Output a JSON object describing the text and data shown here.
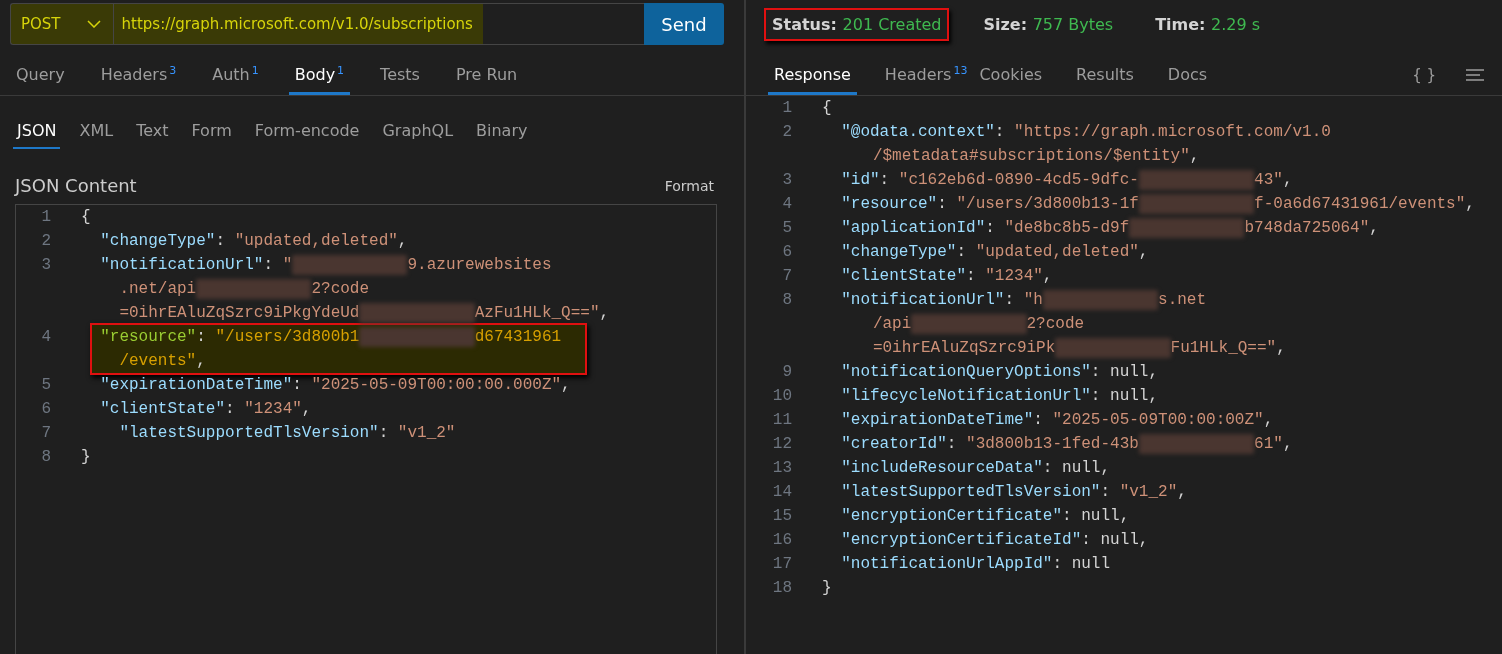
{
  "request": {
    "method": "POST",
    "url": "https://graph.microsoft.com/v1.0/subscriptions",
    "highlighted": true,
    "send": "Send"
  },
  "request_tabs": [
    {
      "label": "Query",
      "selected": false
    },
    {
      "label": "Headers",
      "count": "3",
      "selected": false
    },
    {
      "label": "Auth",
      "count": "1",
      "selected": false
    },
    {
      "label": "Body",
      "count": "1",
      "selected": true
    },
    {
      "label": "Tests",
      "selected": false
    },
    {
      "label": "Pre Run",
      "selected": false
    }
  ],
  "body_tabs": [
    {
      "label": "JSON",
      "selected": true
    },
    {
      "label": "XML",
      "selected": false
    },
    {
      "label": "Text",
      "selected": false
    },
    {
      "label": "Form",
      "selected": false
    },
    {
      "label": "Form-encode",
      "selected": false
    },
    {
      "label": "GraphQL",
      "selected": false
    },
    {
      "label": "Binary",
      "selected": false
    }
  ],
  "body_title": "JSON Content",
  "format": "Format",
  "request_body": [
    {
      "n": "1",
      "kind": "brace",
      "highlighted": false,
      "rows": [
        {
          "tokens": [
            {
              "kind": "punct",
              "text": "{"
            }
          ]
        }
      ]
    },
    {
      "n": "2",
      "kind": "member",
      "highlighted": false,
      "rows": [
        {
          "tokens": [
            {
              "kind": "key",
              "text": "\"changeType\""
            },
            {
              "kind": "punct",
              "text": ": "
            },
            {
              "kind": "string",
              "text": "\"updated,deleted\""
            },
            {
              "kind": "punct",
              "text": ","
            }
          ]
        }
      ]
    },
    {
      "n": "3",
      "kind": "member",
      "highlighted": false,
      "rows": [
        {
          "tokens": [
            {
              "kind": "key",
              "text": "\"notificationUrl\""
            },
            {
              "kind": "punct",
              "text": ": "
            },
            {
              "kind": "string",
              "text": "\""
            },
            {
              "kind": "redacted"
            },
            {
              "kind": "string",
              "text": "9.azurewebsites"
            }
          ]
        },
        {
          "tokens": [
            {
              "kind": "string",
              "text": ".net/api"
            },
            {
              "kind": "redacted"
            },
            {
              "kind": "string",
              "text": "2?code"
            }
          ]
        },
        {
          "tokens": [
            {
              "kind": "string",
              "text": "=0ihrEAluZqSzrc9iPkgYdeUd"
            },
            {
              "kind": "redacted"
            },
            {
              "kind": "string",
              "text": "AzFu1HLk_Q==\""
            },
            {
              "kind": "punct",
              "text": ","
            }
          ]
        }
      ]
    },
    {
      "n": "4",
      "kind": "member",
      "highlighted": true,
      "rows": [
        {
          "tokens": [
            {
              "kind": "key",
              "text": "\"resource\""
            },
            {
              "kind": "punct",
              "text": ": "
            },
            {
              "kind": "string",
              "text": "\"/users/3d800b1"
            },
            {
              "kind": "redacted"
            },
            {
              "kind": "string",
              "text": "d67431961"
            }
          ]
        },
        {
          "tokens": [
            {
              "kind": "string",
              "text": "/events\""
            },
            {
              "kind": "punct",
              "text": ","
            }
          ]
        }
      ]
    },
    {
      "n": "5",
      "kind": "member",
      "highlighted": false,
      "rows": [
        {
          "tokens": [
            {
              "kind": "key",
              "text": "\"expirationDateTime\""
            },
            {
              "kind": "punct",
              "text": ": "
            },
            {
              "kind": "string",
              "text": "\"2025-05-09T00:00:00.000Z\""
            },
            {
              "kind": "punct",
              "text": ","
            }
          ]
        }
      ]
    },
    {
      "n": "6",
      "kind": "member",
      "highlighted": false,
      "rows": [
        {
          "tokens": [
            {
              "kind": "key",
              "text": "\"clientState\""
            },
            {
              "kind": "punct",
              "text": ": "
            },
            {
              "kind": "string",
              "text": "\"1234\""
            },
            {
              "kind": "punct",
              "text": ","
            }
          ]
        }
      ]
    },
    {
      "n": "7",
      "kind": "deep",
      "highlighted": false,
      "rows": [
        {
          "tokens": [
            {
              "kind": "key",
              "text": "\"latestSupportedTlsVersion\""
            },
            {
              "kind": "punct",
              "text": ": "
            },
            {
              "kind": "string",
              "text": "\"v1_2\""
            }
          ]
        }
      ]
    },
    {
      "n": "8",
      "kind": "brace",
      "highlighted": false,
      "rows": [
        {
          "tokens": [
            {
              "kind": "punct",
              "text": "}"
            }
          ]
        }
      ]
    }
  ],
  "status": {
    "outlined": true,
    "items": [
      {
        "label": "Status:",
        "value": "201 Created"
      },
      {
        "label": "Size:",
        "value": "757 Bytes"
      },
      {
        "label": "Time:",
        "value": "2.29 s"
      }
    ]
  },
  "response_tabs": [
    {
      "label": "Response",
      "selected": true
    },
    {
      "label": "Headers",
      "count": "13",
      "selected": false
    },
    {
      "label": "Cookies",
      "selected": false
    },
    {
      "label": "Results",
      "selected": false
    },
    {
      "label": "Docs",
      "selected": false
    }
  ],
  "braces_button": "{ }",
  "response_body": [
    {
      "n": "1",
      "kind": "brace",
      "highlighted": false,
      "rows": [
        {
          "tokens": [
            {
              "kind": "punct",
              "text": "{"
            }
          ]
        }
      ]
    },
    {
      "n": "2",
      "kind": "member",
      "highlighted": false,
      "rows": [
        {
          "tokens": [
            {
              "kind": "key",
              "text": "\"@odata.context\""
            },
            {
              "kind": "punct",
              "text": ": "
            },
            {
              "kind": "string",
              "text": "\"https://graph.microsoft.com/v1.0"
            }
          ]
        },
        {
          "tokens": [
            {
              "kind": "string",
              "text": "/$metadata#subscriptions/$entity\""
            },
            {
              "kind": "punct",
              "text": ","
            }
          ]
        }
      ]
    },
    {
      "n": "3",
      "kind": "member",
      "highlighted": false,
      "rows": [
        {
          "tokens": [
            {
              "kind": "key",
              "text": "\"id\""
            },
            {
              "kind": "punct",
              "text": ": "
            },
            {
              "kind": "string",
              "text": "\"c162eb6d-0890-4cd5-9dfc-"
            },
            {
              "kind": "redacted"
            },
            {
              "kind": "string",
              "text": "43\""
            },
            {
              "kind": "punct",
              "text": ","
            }
          ]
        }
      ]
    },
    {
      "n": "4",
      "kind": "member",
      "highlighted": false,
      "rows": [
        {
          "tokens": [
            {
              "kind": "key",
              "text": "\"resource\""
            },
            {
              "kind": "punct",
              "text": ": "
            },
            {
              "kind": "string",
              "text": "\"/users/3d800b13-1f"
            },
            {
              "kind": "redacted"
            },
            {
              "kind": "string",
              "text": "f-0a6d67431961/events\""
            },
            {
              "kind": "punct",
              "text": ","
            }
          ]
        }
      ]
    },
    {
      "n": "5",
      "kind": "member",
      "highlighted": false,
      "rows": [
        {
          "tokens": [
            {
              "kind": "key",
              "text": "\"applicationId\""
            },
            {
              "kind": "punct",
              "text": ": "
            },
            {
              "kind": "string",
              "text": "\"de8bc8b5-d9f"
            },
            {
              "kind": "redacted"
            },
            {
              "kind": "string",
              "text": "b748da725064\""
            },
            {
              "kind": "punct",
              "text": ","
            }
          ]
        }
      ]
    },
    {
      "n": "6",
      "kind": "member",
      "highlighted": false,
      "rows": [
        {
          "tokens": [
            {
              "kind": "key",
              "text": "\"changeType\""
            },
            {
              "kind": "punct",
              "text": ": "
            },
            {
              "kind": "string",
              "text": "\"updated,deleted\""
            },
            {
              "kind": "punct",
              "text": ","
            }
          ]
        }
      ]
    },
    {
      "n": "7",
      "kind": "member",
      "highlighted": false,
      "rows": [
        {
          "tokens": [
            {
              "kind": "key",
              "text": "\"clientState\""
            },
            {
              "kind": "punct",
              "text": ": "
            },
            {
              "kind": "string",
              "text": "\"1234\""
            },
            {
              "kind": "punct",
              "text": ","
            }
          ]
        }
      ]
    },
    {
      "n": "8",
      "kind": "member",
      "highlighted": false,
      "rows": [
        {
          "tokens": [
            {
              "kind": "key",
              "text": "\"notificationUrl\""
            },
            {
              "kind": "punct",
              "text": ": "
            },
            {
              "kind": "string",
              "text": "\"h"
            },
            {
              "kind": "redacted"
            },
            {
              "kind": "string",
              "text": "s.net"
            }
          ]
        },
        {
          "tokens": [
            {
              "kind": "string",
              "text": "/api"
            },
            {
              "kind": "redacted"
            },
            {
              "kind": "string",
              "text": "2?code"
            }
          ]
        },
        {
          "tokens": [
            {
              "kind": "string",
              "text": "=0ihrEAluZqSzrc9iPk"
            },
            {
              "kind": "redacted"
            },
            {
              "kind": "string",
              "text": "Fu1HLk_Q==\""
            },
            {
              "kind": "punct",
              "text": ","
            }
          ]
        }
      ]
    },
    {
      "n": "9",
      "kind": "member",
      "highlighted": false,
      "rows": [
        {
          "tokens": [
            {
              "kind": "key",
              "text": "\"notificationQueryOptions\""
            },
            {
              "kind": "punct",
              "text": ": "
            },
            {
              "kind": "null",
              "text": "null"
            },
            {
              "kind": "punct",
              "text": ","
            }
          ]
        }
      ]
    },
    {
      "n": "10",
      "kind": "member",
      "highlighted": false,
      "rows": [
        {
          "tokens": [
            {
              "kind": "key",
              "text": "\"lifecycleNotificationUrl\""
            },
            {
              "kind": "punct",
              "text": ": "
            },
            {
              "kind": "null",
              "text": "null"
            },
            {
              "kind": "punct",
              "text": ","
            }
          ]
        }
      ]
    },
    {
      "n": "11",
      "kind": "member",
      "highlighted": false,
      "rows": [
        {
          "tokens": [
            {
              "kind": "key",
              "text": "\"expirationDateTime\""
            },
            {
              "kind": "punct",
              "text": ": "
            },
            {
              "kind": "string",
              "text": "\"2025-05-09T00:00:00Z\""
            },
            {
              "kind": "punct",
              "text": ","
            }
          ]
        }
      ]
    },
    {
      "n": "12",
      "kind": "member",
      "highlighted": false,
      "rows": [
        {
          "tokens": [
            {
              "kind": "key",
              "text": "\"creatorId\""
            },
            {
              "kind": "punct",
              "text": ": "
            },
            {
              "kind": "string",
              "text": "\"3d800b13-1fed-43b"
            },
            {
              "kind": "redacted"
            },
            {
              "kind": "string",
              "text": "61\""
            },
            {
              "kind": "punct",
              "text": ","
            }
          ]
        }
      ]
    },
    {
      "n": "13",
      "kind": "member",
      "highlighted": false,
      "rows": [
        {
          "tokens": [
            {
              "kind": "key",
              "text": "\"includeResourceData\""
            },
            {
              "kind": "punct",
              "text": ": "
            },
            {
              "kind": "null",
              "text": "null"
            },
            {
              "kind": "punct",
              "text": ","
            }
          ]
        }
      ]
    },
    {
      "n": "14",
      "kind": "member",
      "highlighted": false,
      "rows": [
        {
          "tokens": [
            {
              "kind": "key",
              "text": "\"latestSupportedTlsVersion\""
            },
            {
              "kind": "punct",
              "text": ": "
            },
            {
              "kind": "string",
              "text": "\"v1_2\""
            },
            {
              "kind": "punct",
              "text": ","
            }
          ]
        }
      ]
    },
    {
      "n": "15",
      "kind": "member",
      "highlighted": false,
      "rows": [
        {
          "tokens": [
            {
              "kind": "key",
              "text": "\"encryptionCertificate\""
            },
            {
              "kind": "punct",
              "text": ": "
            },
            {
              "kind": "null",
              "text": "null"
            },
            {
              "kind": "punct",
              "text": ","
            }
          ]
        }
      ]
    },
    {
      "n": "16",
      "kind": "member",
      "highlighted": false,
      "rows": [
        {
          "tokens": [
            {
              "kind": "key",
              "text": "\"encryptionCertificateId\""
            },
            {
              "kind": "punct",
              "text": ": "
            },
            {
              "kind": "null",
              "text": "null"
            },
            {
              "kind": "punct",
              "text": ","
            }
          ]
        }
      ]
    },
    {
      "n": "17",
      "kind": "member",
      "highlighted": false,
      "rows": [
        {
          "tokens": [
            {
              "kind": "key",
              "text": "\"notificationUrlAppId\""
            },
            {
              "kind": "punct",
              "text": ": "
            },
            {
              "kind": "null",
              "text": "null"
            }
          ]
        }
      ]
    },
    {
      "n": "18",
      "kind": "brace",
      "highlighted": false,
      "rows": [
        {
          "tokens": [
            {
              "kind": "punct",
              "text": "}"
            }
          ]
        }
      ]
    }
  ]
}
